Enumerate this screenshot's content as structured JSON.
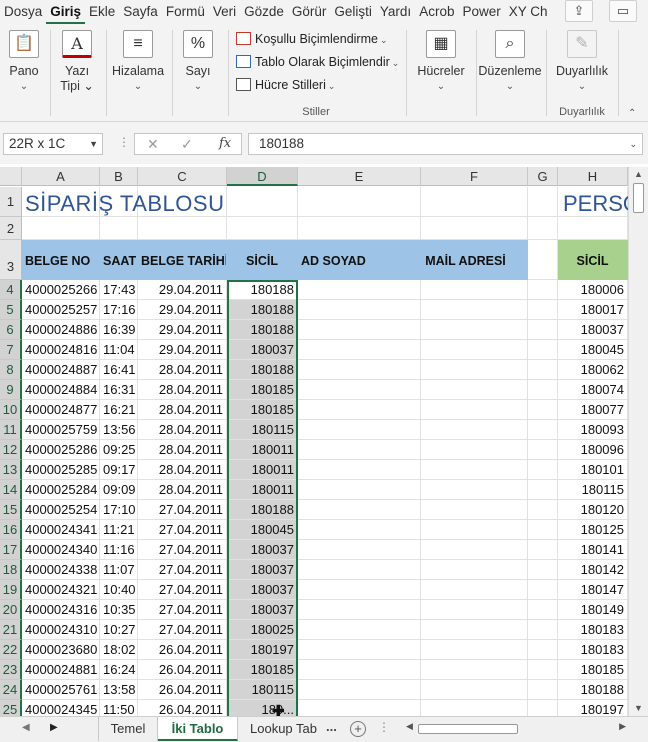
{
  "ribbon_tabs": [
    "Dosya",
    "Giriş",
    "Ekle",
    "Sayfa",
    "Formü",
    "Veri",
    "Gözde",
    "Görür",
    "Gelişti",
    "Yardı",
    "Acrob",
    "Power",
    "XY Ch"
  ],
  "ribbon_active_tab": "Giriş",
  "ribbon": {
    "pano": {
      "label": "Pano",
      "drop": "⌄"
    },
    "yazi": {
      "label": "Yazı",
      "label2": "Tipi ⌄"
    },
    "hizalama": {
      "label": "Hizalama",
      "drop": "⌄"
    },
    "sayi": {
      "label": "Sayı",
      "drop": "⌄",
      "icon": "%"
    },
    "styles": {
      "conditional": "Koşullu Biçimlendirme",
      "table": "Tablo Olarak Biçimlendir",
      "cell_styles": "Hücre Stilleri",
      "group_label": "Stiller"
    },
    "hucreler": {
      "label": "Hücreler",
      "drop": "⌄"
    },
    "duzenleme": {
      "label": "Düzenleme",
      "drop": "⌄"
    },
    "duyarlilik": {
      "label": "Duyarlılık",
      "drop": "⌄",
      "group_label": "Duyarlılık"
    }
  },
  "formula_bar": {
    "name_box": "22R x 1C",
    "formula": "180188"
  },
  "columns": [
    "A",
    "B",
    "C",
    "D",
    "E",
    "F",
    "G",
    "H"
  ],
  "rows": [
    "1",
    "2",
    "3",
    "4",
    "5",
    "6",
    "7",
    "8",
    "9",
    "10",
    "11",
    "12",
    "13",
    "14",
    "15",
    "16",
    "17",
    "18",
    "19",
    "20",
    "21",
    "22",
    "23",
    "24",
    "25"
  ],
  "sheet": {
    "title": "SİPARİŞ TABLOSU",
    "title2": "PERSO",
    "headers": {
      "belge_no": "BELGE NO",
      "saat": "SAAT",
      "belge_tarihi": "BELGE TARİHİ",
      "sicil": "SİCİL",
      "ad_soyad": "AD SOYAD",
      "mail": "MAİL ADRESİ",
      "sicil2": "SİCİL"
    },
    "data_rows": [
      [
        "4000025266",
        "17:43",
        "29.04.2011",
        "180188",
        "180006"
      ],
      [
        "4000025257",
        "17:16",
        "29.04.2011",
        "180188",
        "180017"
      ],
      [
        "4000024886",
        "16:39",
        "29.04.2011",
        "180188",
        "180037"
      ],
      [
        "4000024816",
        "11:04",
        "29.04.2011",
        "180037",
        "180045"
      ],
      [
        "4000024887",
        "16:41",
        "28.04.2011",
        "180188",
        "180062"
      ],
      [
        "4000024884",
        "16:31",
        "28.04.2011",
        "180185",
        "180074"
      ],
      [
        "4000024877",
        "16:21",
        "28.04.2011",
        "180185",
        "180077"
      ],
      [
        "4000025759",
        "13:56",
        "28.04.2011",
        "180115",
        "180093"
      ],
      [
        "4000025286",
        "09:25",
        "28.04.2011",
        "180011",
        "180096"
      ],
      [
        "4000025285",
        "09:17",
        "28.04.2011",
        "180011",
        "180101"
      ],
      [
        "4000025284",
        "09:09",
        "28.04.2011",
        "180011",
        "180115"
      ],
      [
        "4000025254",
        "17:10",
        "27.04.2011",
        "180188",
        "180120"
      ],
      [
        "4000024341",
        "11:21",
        "27.04.2011",
        "180045",
        "180125"
      ],
      [
        "4000024340",
        "11:16",
        "27.04.2011",
        "180037",
        "180141"
      ],
      [
        "4000024338",
        "11:07",
        "27.04.2011",
        "180037",
        "180142"
      ],
      [
        "4000024321",
        "10:40",
        "27.04.2011",
        "180037",
        "180147"
      ],
      [
        "4000024316",
        "10:35",
        "27.04.2011",
        "180037",
        "180149"
      ],
      [
        "4000024310",
        "10:27",
        "27.04.2011",
        "180025",
        "180183"
      ],
      [
        "4000023680",
        "18:02",
        "26.04.2011",
        "180197",
        "180183"
      ],
      [
        "4000024881",
        "16:24",
        "26.04.2011",
        "180185",
        "180185"
      ],
      [
        "4000025761",
        "13:58",
        "26.04.2011",
        "180115",
        "180188"
      ],
      [
        "4000024345",
        "11:50",
        "26.04.2011",
        "180...",
        "180197"
      ]
    ]
  },
  "sheet_tabs": [
    "Temel",
    "İki Tablo",
    "Lookup Tab"
  ],
  "active_sheet": "İki Tablo",
  "sheet_more": "...",
  "colors": {
    "header_blue": "#9dc3e6",
    "header_green": "#a9d18e",
    "accent": "#217346",
    "title": "#2f5597"
  }
}
